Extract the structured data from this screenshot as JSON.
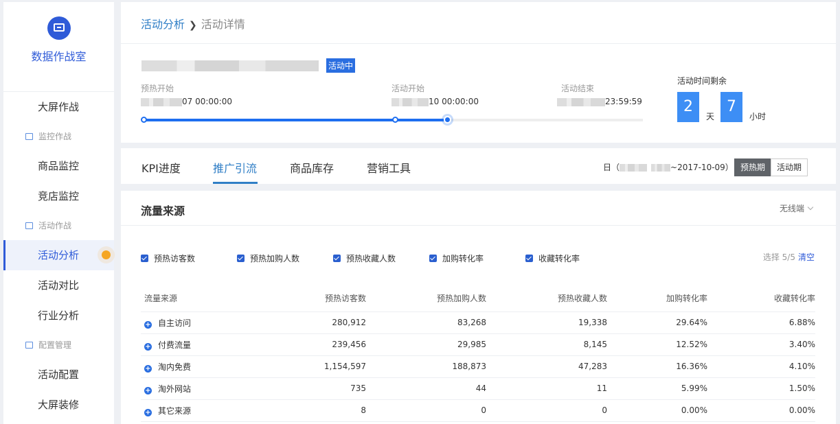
{
  "sidebar": {
    "logo_title": "数据作战室",
    "items": [
      {
        "type": "item",
        "label": "大屏作战"
      },
      {
        "type": "group",
        "label": "监控作战"
      },
      {
        "type": "item",
        "label": "商品监控"
      },
      {
        "type": "item",
        "label": "竞店监控"
      },
      {
        "type": "group",
        "label": "活动作战"
      },
      {
        "type": "item",
        "label": "活动分析",
        "active": true
      },
      {
        "type": "item",
        "label": "活动对比"
      },
      {
        "type": "item",
        "label": "行业分析"
      },
      {
        "type": "group",
        "label": "配置管理"
      },
      {
        "type": "item",
        "label": "活动配置"
      },
      {
        "type": "item",
        "label": "大屏装修"
      }
    ]
  },
  "breadcrumb": {
    "parent": "活动分析",
    "current": "活动详情"
  },
  "activity": {
    "status_badge": "活动中",
    "phases": [
      {
        "label": "预热开始",
        "time_suffix": "07 00:00:00"
      },
      {
        "label": "活动开始",
        "time_suffix": "10 00:00:00"
      },
      {
        "label": "活动结束",
        "time_suffix": "23:59:59"
      }
    ],
    "progress_percent": 61,
    "remaining": {
      "label": "活动时间剩余",
      "days": "2",
      "days_unit": "天",
      "hours": "7",
      "hours_unit": "小时"
    }
  },
  "tabs": {
    "items": [
      "KPI进度",
      "推广引流",
      "商品库存",
      "营销工具"
    ],
    "active_index": 1,
    "date_prefix": "日（",
    "date_suffix": "~2017-10-09）",
    "period_options": [
      "预热期",
      "活动期"
    ],
    "period_selected": "预热期"
  },
  "traffic": {
    "title": "流量来源",
    "device": "无线端",
    "metrics": [
      "预热访客数",
      "预热加购人数",
      "预热收藏人数",
      "加购转化率",
      "收藏转化率"
    ],
    "selection_text": "选择 5/5",
    "clear_label": "清空",
    "columns": [
      "流量来源",
      "预热访客数",
      "预热加购人数",
      "预热收藏人数",
      "加购转化率",
      "收藏转化率"
    ],
    "rows": [
      [
        "自主访问",
        "280,912",
        "83,268",
        "19,338",
        "29.64%",
        "6.88%"
      ],
      [
        "付费流量",
        "239,456",
        "29,985",
        "8,145",
        "12.52%",
        "3.40%"
      ],
      [
        "淘内免费",
        "1,154,597",
        "188,873",
        "47,283",
        "16.36%",
        "4.10%"
      ],
      [
        "淘外网站",
        "735",
        "44",
        "11",
        "5.99%",
        "1.50%"
      ],
      [
        "其它来源",
        "8",
        "0",
        "0",
        "0.00%",
        "0.00%"
      ]
    ]
  },
  "colors": {
    "accent": "#2f5bd8",
    "progress": "#1d6ef0",
    "countdown": "#3d8ef5",
    "badge": "#2a6ee0",
    "dot": "#f5a623"
  }
}
